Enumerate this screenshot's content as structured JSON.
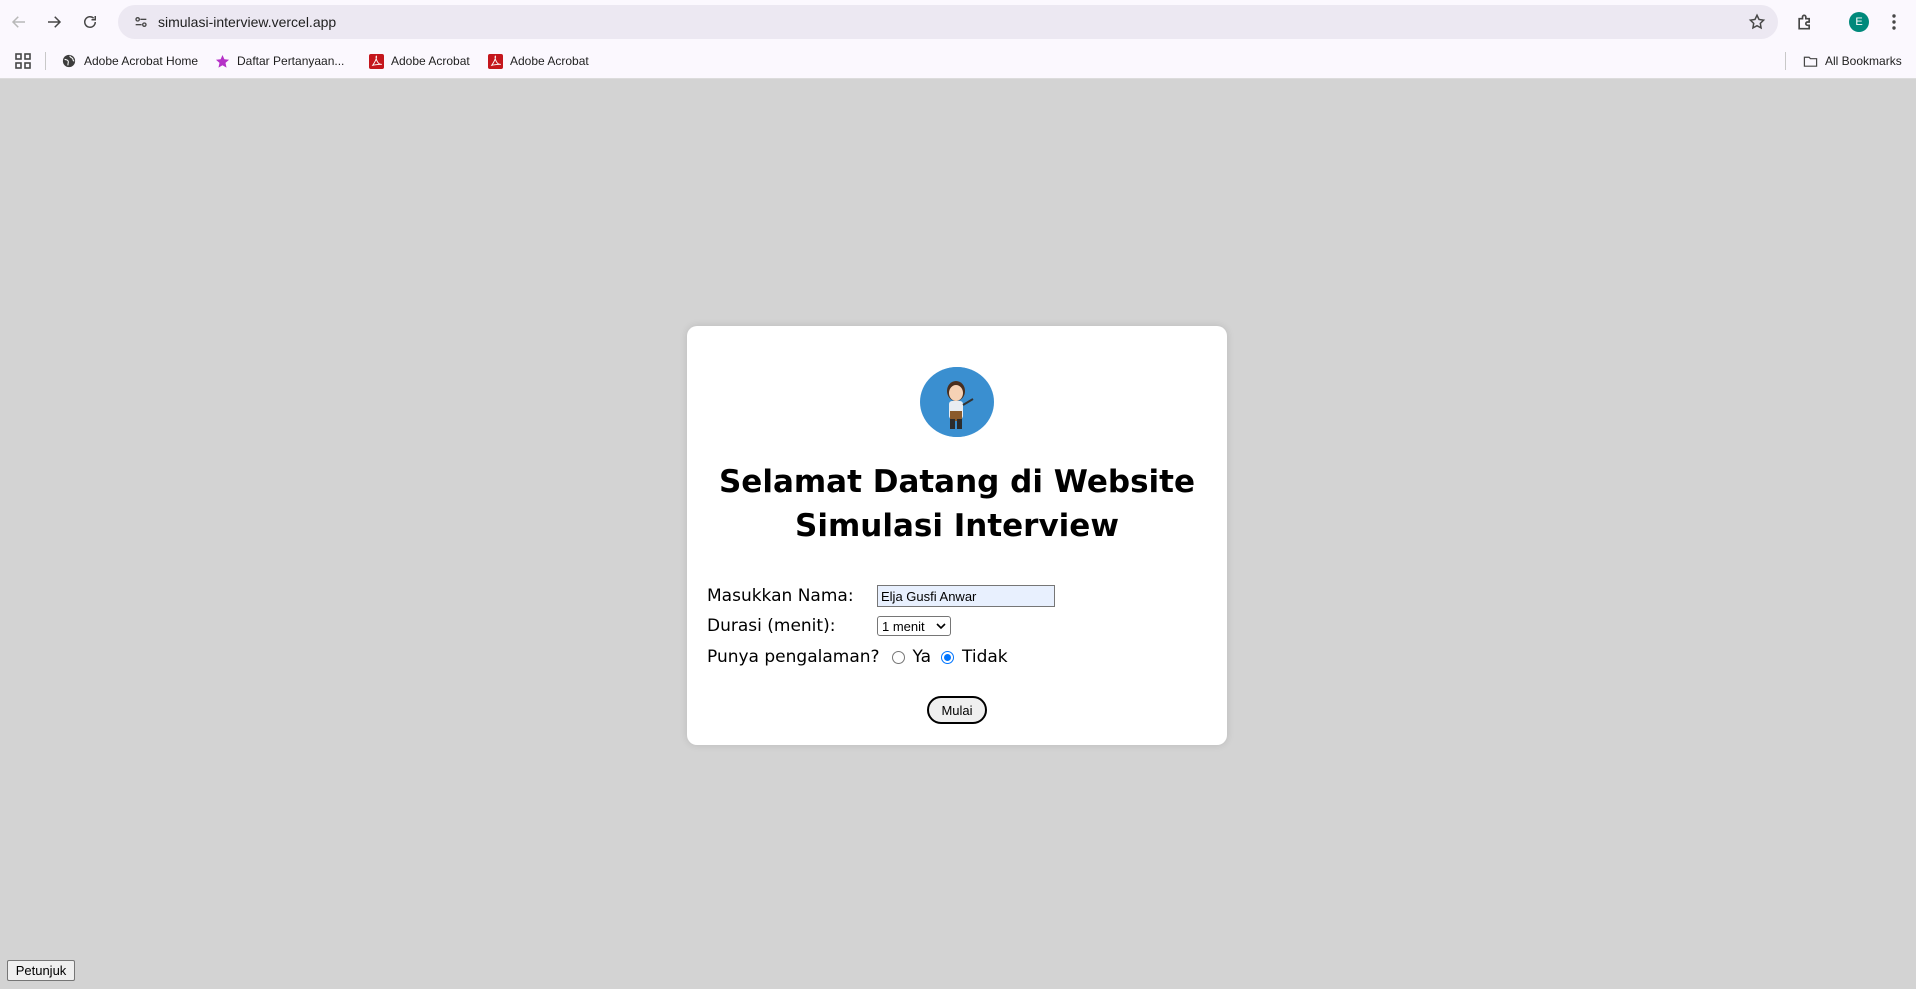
{
  "browser": {
    "url": "simulasi-interview.vercel.app",
    "profile_initial": "E",
    "bookmarks": [
      {
        "label": "Adobe Acrobat Home",
        "icon": "globe-icon"
      },
      {
        "label": "Daftar Pertanyaan...",
        "icon": "star-icon"
      },
      {
        "label": "Adobe Acrobat",
        "icon": "acrobat-icon"
      },
      {
        "label": "Adobe Acrobat",
        "icon": "acrobat-icon"
      }
    ],
    "all_bookmarks_label": "All Bookmarks"
  },
  "page": {
    "title_line1": "Selamat Datang di Website",
    "title_line2": "Simulasi Interview",
    "name_label": "Masukkan Nama:",
    "name_value": "Elja Gusfi Anwar",
    "duration_label": "Durasi (menit):",
    "duration_selected": "1 menit",
    "experience_label": "Punya pengalaman?",
    "experience_options": [
      {
        "label": "Ya",
        "checked": false
      },
      {
        "label": "Tidak",
        "checked": true
      }
    ],
    "start_button": "Mulai",
    "help_button": "Petunjuk"
  },
  "colors": {
    "page_bg": "#d3d3d3",
    "avatar_bg": "#3a8fd0",
    "radio_accent": "#0075ff"
  }
}
